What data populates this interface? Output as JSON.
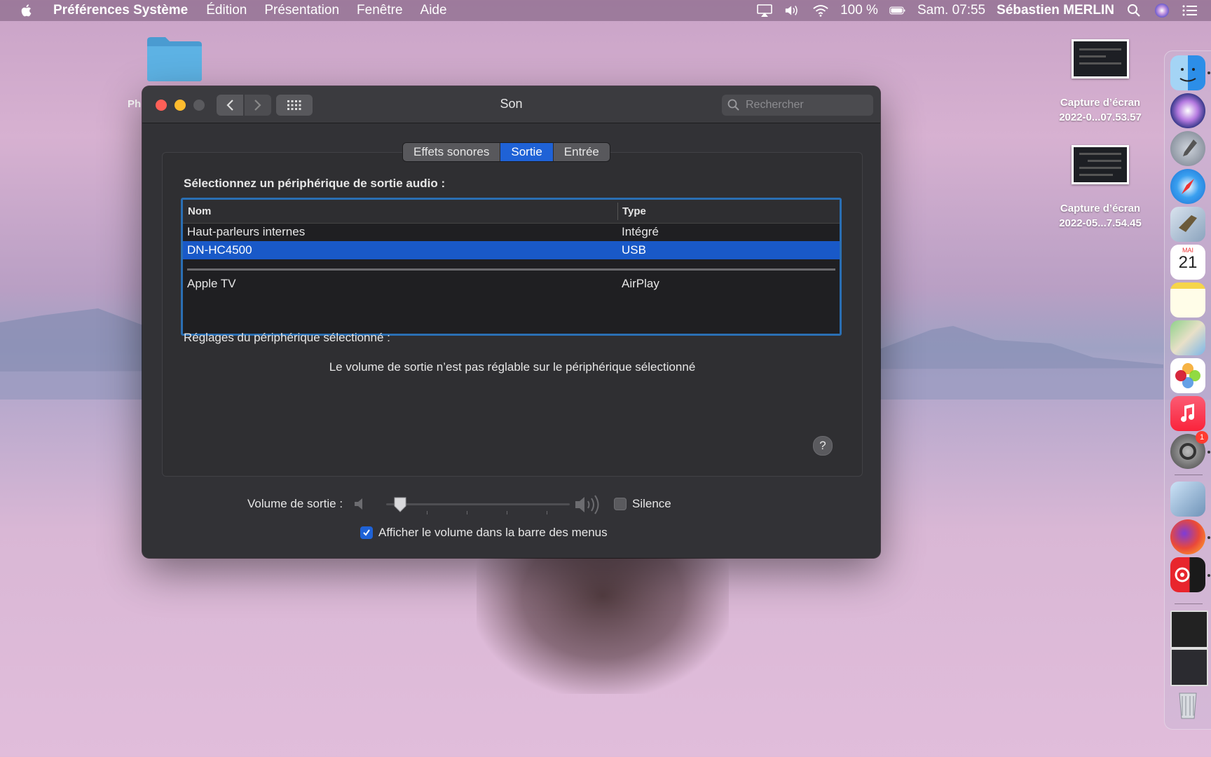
{
  "menubar": {
    "app_name": "Préférences Système",
    "menus": [
      "Édition",
      "Présentation",
      "Fenêtre",
      "Aide"
    ],
    "battery": "100 %",
    "clock": "Sam. 07:55",
    "user": "Sébastien MERLIN"
  },
  "desktop": {
    "folder_label": "Ph",
    "files": [
      {
        "line1": "Capture d’écran",
        "line2": "2022-0...07.53.57"
      },
      {
        "line1": "Capture d’écran",
        "line2": "2022-05...7.54.45"
      }
    ]
  },
  "dock": {
    "items": [
      "finder-icon",
      "siri-icon",
      "launchpad-icon",
      "safari-icon",
      "mail-icon",
      "calendar-icon",
      "notes-icon",
      "maps-icon",
      "photos-icon",
      "music-icon",
      "system-preferences-icon",
      "preview-icon",
      "firefox-icon",
      "vinyls-icon",
      "screenshot-thumb-1",
      "screenshot-thumb-2",
      "trash-icon"
    ],
    "calendar_month": "MAI",
    "calendar_day": "21",
    "prefs_badge": "1"
  },
  "window": {
    "title": "Son",
    "search_placeholder": "Rechercher",
    "tabs": [
      {
        "label": "Effets sonores",
        "active": false
      },
      {
        "label": "Sortie",
        "active": true
      },
      {
        "label": "Entrée",
        "active": false
      }
    ],
    "select_label": "Sélectionnez un périphérique de sortie audio :",
    "table": {
      "headers": {
        "name": "Nom",
        "type": "Type"
      },
      "rows": [
        {
          "name": "Haut-parleurs internes",
          "type": "Intégré",
          "selected": false
        },
        {
          "name": "DN-HC4500",
          "type": "USB",
          "selected": true
        },
        {
          "name": "Apple TV",
          "type": "AirPlay",
          "selected": false
        }
      ]
    },
    "settings_label": "Réglages du périphérique sélectionné :",
    "info_text": "Le volume de sortie n’est pas réglable sur le périphérique sélectionné",
    "help_label": "?",
    "volume_label": "Volume de sortie :",
    "volume_level": 0.04,
    "silence_label": "Silence",
    "silence_checked": false,
    "menu_volume_label": "Afficher le volume dans la barre des menus",
    "menu_volume_checked": true
  },
  "colors": {
    "accent": "#1f62d6",
    "selection": "#1959c8",
    "window_bg": "#323236"
  }
}
